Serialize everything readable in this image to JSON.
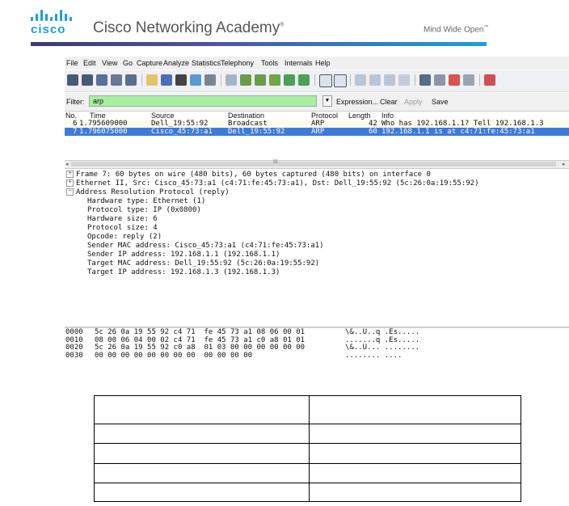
{
  "header": {
    "brand": "cisco",
    "title": "Cisco Networking Academy",
    "trademark": "®",
    "tagline": "Mind Wide Open",
    "tagline_mark": "™",
    "brand_color": "#1ba0d7"
  },
  "wireshark": {
    "menu": [
      "File",
      "Edit",
      "View",
      "Go",
      "Capture",
      "Analyze",
      "Statistics",
      "Telephony",
      "Tools",
      "Internals",
      "Help"
    ],
    "filter": {
      "label": "Filter:",
      "value": "arp",
      "expression": "Expression...",
      "clear": "Clear",
      "apply": "Apply",
      "save": "Save",
      "color": "#a6f0a0"
    },
    "columns": [
      "No.",
      "Time",
      "Source",
      "Destination",
      "Protocol",
      "Length",
      "Info"
    ],
    "packets": [
      {
        "no": "6",
        "time": "1.795609000",
        "source": "Dell_19:55:92",
        "destination": "Broadcast",
        "protocol": "ARP",
        "length": "42",
        "info": "Who has 192.168.1.1?  Tell 192.168.1.3"
      },
      {
        "no": "7",
        "time": "1.796075000",
        "source": "Cisco_45:73:a1",
        "destination": "Dell_19:55:92",
        "protocol": "ARP",
        "length": "60",
        "info": "192.168.1.1 is at c4:71:fe:45:73:a1"
      }
    ],
    "selected_color": "#3d7bd9",
    "scroll_grip": "III",
    "details": {
      "frame": "Frame 7: 60 bytes on wire (480 bits), 60 bytes captured (480 bits) on interface 0",
      "ethernet": "Ethernet II, Src: Cisco_45:73:a1 (c4:71:fe:45:73:a1), Dst: Dell_19:55:92 (5c:26:0a:19:55:92)",
      "arp": "Address Resolution Protocol (reply)",
      "arp_fields": [
        "Hardware type: Ethernet (1)",
        "Protocol type: IP (0x0800)",
        "Hardware size: 6",
        "Protocol size: 4",
        "Opcode: reply (2)",
        "Sender MAC address: Cisco_45:73:a1 (c4:71:fe:45:73:a1)",
        "Sender IP address: 192.168.1.1 (192.168.1.1)",
        "Target MAC address: Dell_19:55:92 (5c:26:0a:19:55:92)",
        "Target IP address: 192.168.1.3 (192.168.1.3)"
      ]
    },
    "hex_rows": [
      {
        "offset": "0000",
        "bytes": "5c 26 0a 19 55 92 c4 71  fe 45 73 a1 08 06 00 01",
        "ascii": "\\&..U..q .Es....."
      },
      {
        "offset": "0010",
        "bytes": "08 00 06 04 00 02 c4 71  fe 45 73 a1 c0 a8 01 01",
        "ascii": ".......q .Es....."
      },
      {
        "offset": "0020",
        "bytes": "5c 26 0a 19 55 92 c0 a8  01 03 00 00 00 00 00 00",
        "ascii": "\\&..U... ........"
      },
      {
        "offset": "0030",
        "bytes": "00 00 00 00 00 00 00 00  00 00 00 00",
        "ascii": "........ ...."
      }
    ]
  },
  "answer_table": {
    "rows": [
      [
        "",
        ""
      ],
      [
        "",
        ""
      ],
      [
        "",
        ""
      ],
      [
        "",
        ""
      ],
      [
        "",
        ""
      ]
    ]
  }
}
